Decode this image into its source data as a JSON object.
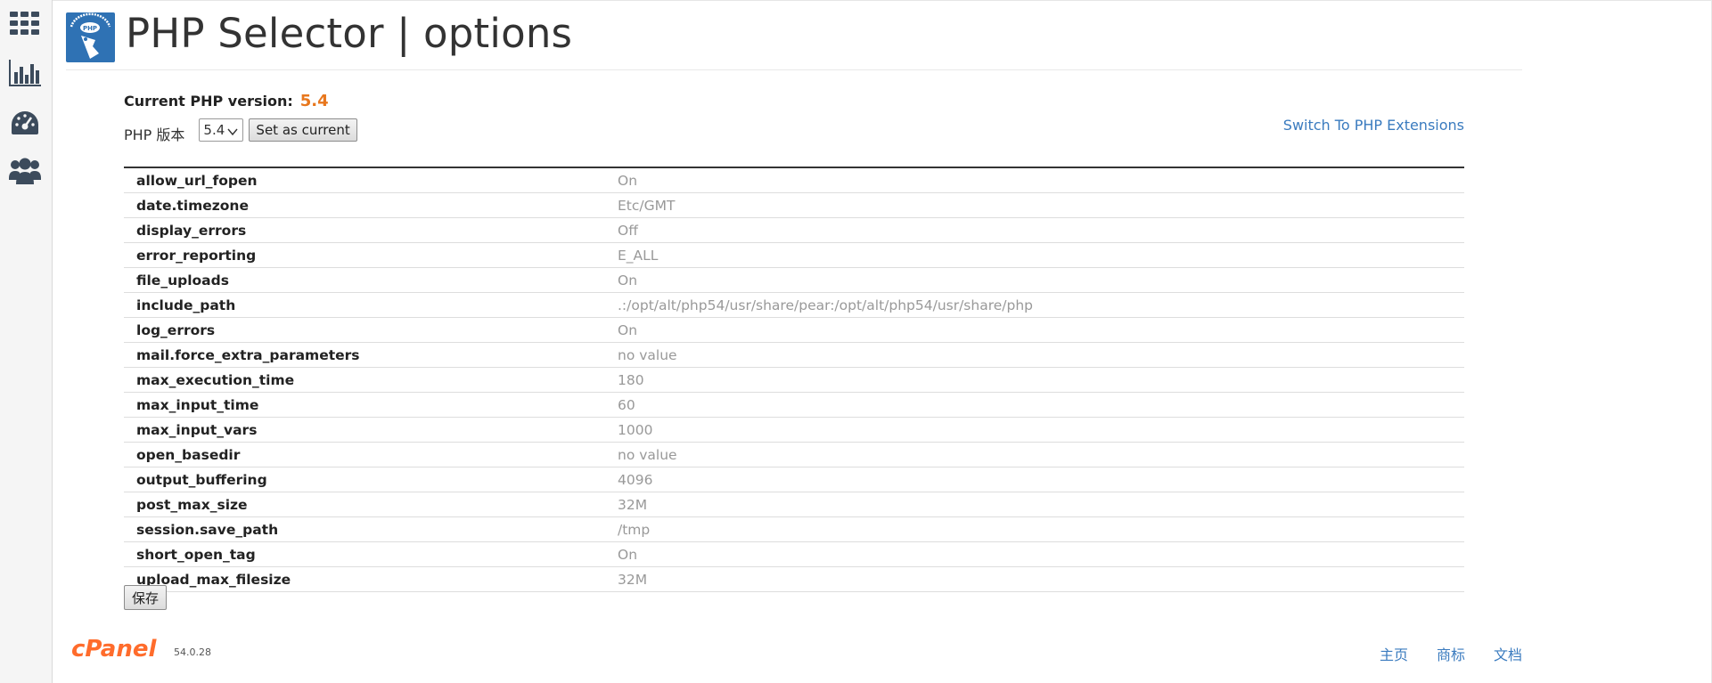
{
  "header": {
    "title": "PHP Selector | options"
  },
  "sidebar": {
    "icons": [
      "grid-icon",
      "bar-chart-icon",
      "dashboard-gauge-icon",
      "users-icon"
    ]
  },
  "version": {
    "label": "Current PHP version:",
    "value": "5.4",
    "select_label": "PHP 版本",
    "selected": "5.4",
    "set_button": "Set as current"
  },
  "switch_link": "Switch To PHP Extensions",
  "options": [
    {
      "key": "allow_url_fopen",
      "value": "On"
    },
    {
      "key": "date.timezone",
      "value": "Etc/GMT"
    },
    {
      "key": "display_errors",
      "value": "Off"
    },
    {
      "key": "error_reporting",
      "value": "E_ALL"
    },
    {
      "key": "file_uploads",
      "value": "On"
    },
    {
      "key": "include_path",
      "value": ".:/opt/alt/php54/usr/share/pear:/opt/alt/php54/usr/share/php"
    },
    {
      "key": "log_errors",
      "value": "On"
    },
    {
      "key": "mail.force_extra_parameters",
      "value": "no value"
    },
    {
      "key": "max_execution_time",
      "value": "180"
    },
    {
      "key": "max_input_time",
      "value": "60"
    },
    {
      "key": "max_input_vars",
      "value": "1000"
    },
    {
      "key": "open_basedir",
      "value": "no value"
    },
    {
      "key": "output_buffering",
      "value": "4096"
    },
    {
      "key": "post_max_size",
      "value": "32M"
    },
    {
      "key": "session.save_path",
      "value": "/tmp"
    },
    {
      "key": "short_open_tag",
      "value": "On"
    },
    {
      "key": "upload_max_filesize",
      "value": "32M"
    }
  ],
  "save_button": "保存",
  "footer": {
    "brand": "cPanel",
    "version": "54.0.28",
    "links": [
      "主页",
      "商标",
      "文档"
    ]
  },
  "colors": {
    "accent_orange": "#e8771d",
    "link_blue": "#3a7bbf",
    "logo_blue": "#2f72b4"
  }
}
